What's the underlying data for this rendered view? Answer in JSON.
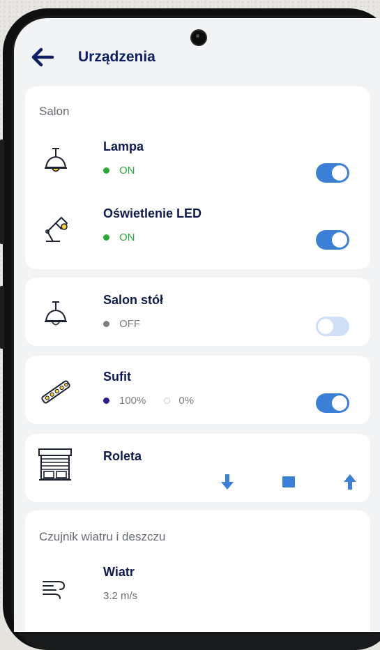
{
  "header": {
    "title": "Urządzenia"
  },
  "colors": {
    "accent": "#3c7fd6",
    "on": "#2ca83a",
    "off": "#7b7d82",
    "title": "#0f1f63",
    "dimmer_dot": "#2a1d85"
  },
  "groups": [
    {
      "title": "Salon",
      "devices": [
        {
          "name": "Lampa",
          "icon": "pendant-lamp-icon",
          "status": "ON",
          "toggle": true
        },
        {
          "name": "Oświetlenie LED",
          "icon": "desk-lamp-icon",
          "status": "ON",
          "toggle": true
        }
      ]
    }
  ],
  "single_devices": {
    "salon_stol": {
      "name": "Salon stół",
      "icon": "pendant-lamp-icon",
      "status": "OFF",
      "toggle": false
    },
    "sufit": {
      "name": "Sufit",
      "icon": "led-strip-icon",
      "level_on": "100%",
      "level_off": "0%",
      "toggle": true
    },
    "roleta": {
      "name": "Roleta",
      "icon": "roller-shutter-icon",
      "controls": [
        "arrow-down-icon",
        "stop-icon",
        "arrow-up-icon"
      ]
    }
  },
  "sensor_group": {
    "title": "Czujnik wiatru i deszczu",
    "devices": [
      {
        "name": "Wiatr",
        "icon": "wind-icon",
        "value": "3.2 m/s"
      }
    ]
  }
}
